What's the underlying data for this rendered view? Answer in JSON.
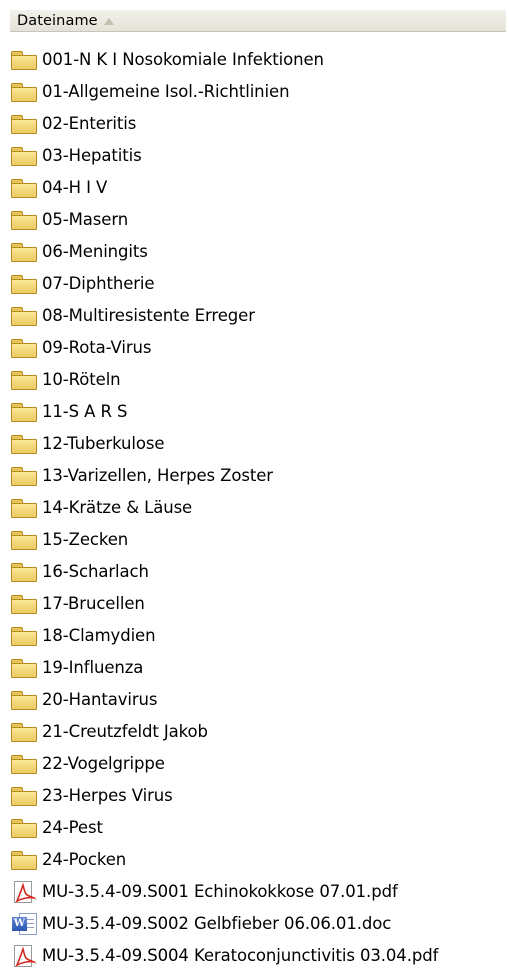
{
  "header": {
    "column_label": "Dateiname"
  },
  "items": [
    {
      "type": "folder",
      "label": "001-N K I Nosokomiale Infektionen"
    },
    {
      "type": "folder",
      "label": "01-Allgemeine Isol.-Richtlinien"
    },
    {
      "type": "folder",
      "label": "02-Enteritis"
    },
    {
      "type": "folder",
      "label": "03-Hepatitis"
    },
    {
      "type": "folder",
      "label": "04-H I V"
    },
    {
      "type": "folder",
      "label": "05-Masern"
    },
    {
      "type": "folder",
      "label": "06-Meningits"
    },
    {
      "type": "folder",
      "label": "07-Diphtherie"
    },
    {
      "type": "folder",
      "label": "08-Multiresistente Erreger"
    },
    {
      "type": "folder",
      "label": "09-Rota-Virus"
    },
    {
      "type": "folder",
      "label": "10-Röteln"
    },
    {
      "type": "folder",
      "label": "11-S A R S"
    },
    {
      "type": "folder",
      "label": "12-Tuberkulose"
    },
    {
      "type": "folder",
      "label": "13-Varizellen, Herpes Zoster"
    },
    {
      "type": "folder",
      "label": "14-Krätze &  Läuse"
    },
    {
      "type": "folder",
      "label": "15-Zecken"
    },
    {
      "type": "folder",
      "label": "16-Scharlach"
    },
    {
      "type": "folder",
      "label": "17-Brucellen"
    },
    {
      "type": "folder",
      "label": "18-Clamydien"
    },
    {
      "type": "folder",
      "label": "19-Influenza"
    },
    {
      "type": "folder",
      "label": "20-Hantavirus"
    },
    {
      "type": "folder",
      "label": "21-Creutzfeldt Jakob"
    },
    {
      "type": "folder",
      "label": "22-Vogelgrippe"
    },
    {
      "type": "folder",
      "label": "23-Herpes Virus"
    },
    {
      "type": "folder",
      "label": "24-Pest"
    },
    {
      "type": "folder",
      "label": "24-Pocken"
    },
    {
      "type": "pdf",
      "label": "MU-3.5.4-09.S001 Echinokokkose 07.01.pdf"
    },
    {
      "type": "doc",
      "label": "MU-3.5.4-09.S002 Gelbfieber 06.06.01.doc"
    },
    {
      "type": "pdf",
      "label": "MU-3.5.4-09.S004 Keratoconjunctivitis 03.04.pdf"
    }
  ],
  "icon_names": {
    "folder": "folder-icon",
    "pdf": "pdf-file-icon",
    "doc": "word-document-icon"
  },
  "colors": {
    "header_bg": "#ebe9df",
    "folder_fill": "#f3d978",
    "folder_border": "#b48a1e",
    "pdf_red": "#d42a1f",
    "word_blue": "#2e56b0"
  }
}
